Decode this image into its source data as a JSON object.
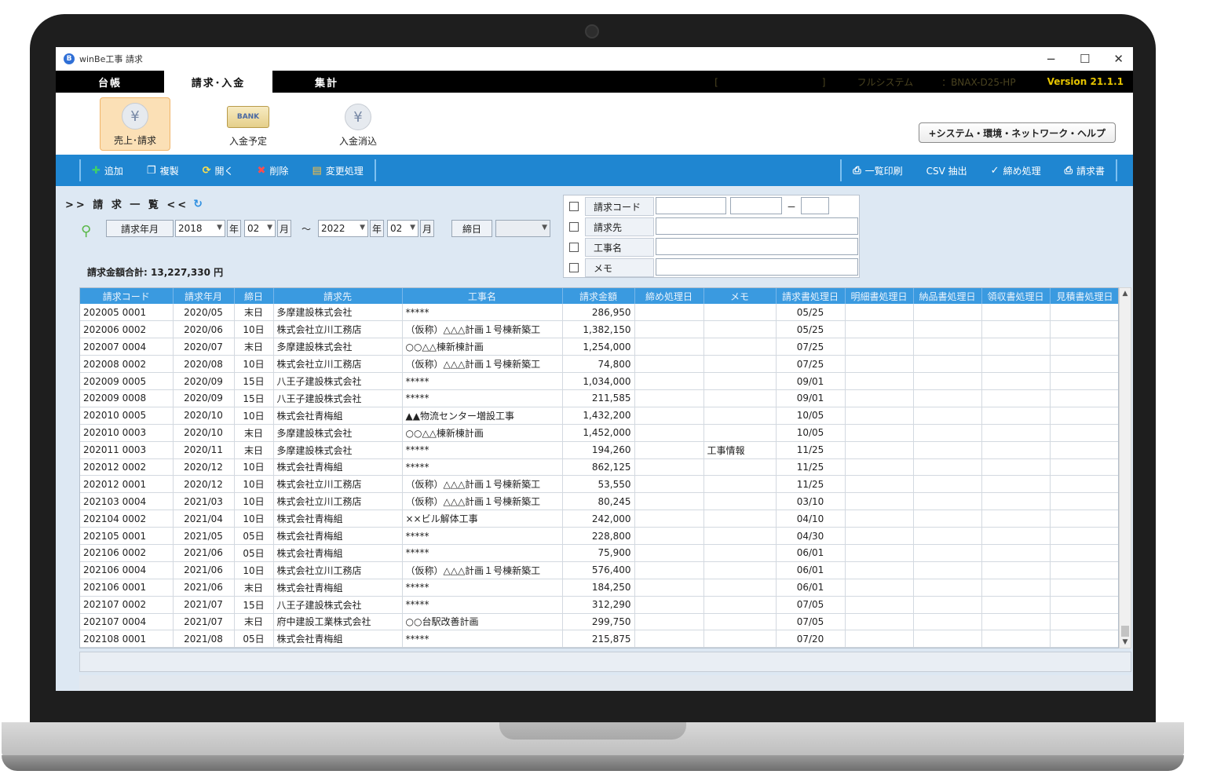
{
  "window": {
    "title": "winBe工事 請求",
    "controls": [
      "−",
      "☐",
      "✕"
    ]
  },
  "tabs": [
    {
      "label": "台帳"
    },
    {
      "label": "請求･入金"
    },
    {
      "label": "集計"
    }
  ],
  "tab_info": {
    "blurred_1": "[　　　　　　　　　　　]",
    "blurred_2": "フルシステム　　　：BNAX-D25-HP",
    "version": "Version 21.1.1"
  },
  "ribbon": {
    "sales_billing": "売上･請求",
    "bank_icon_text": "BANK",
    "deposit_plan": "入金予定",
    "deposit_clear": "入金消込",
    "yen_symbol": "¥",
    "system_help": "+システム・環境・ネットワーク・ヘルプ"
  },
  "toolbar": {
    "add": "追加",
    "copy": "複製",
    "open": "開く",
    "delete": "削除",
    "change": "変更処理",
    "list_print": "一覧印刷",
    "csv_extract": "CSV 抽出",
    "closing": "締め処理",
    "invoice": "請求書"
  },
  "list": {
    "title": ">> 請 求 一 覧 <<",
    "total_label": "請求金額合計:",
    "total_value": "13,227,330 円"
  },
  "period": {
    "label": "請求年月",
    "from_year": "2018",
    "from_month": "02",
    "to_year": "2022",
    "to_month": "02",
    "year_unit": "年",
    "month_unit": "月",
    "tilde": "～",
    "closing_label": "締日",
    "closing_value": ""
  },
  "filters": {
    "code_label": "請求コード",
    "code_dash": "－",
    "client_label": "請求先",
    "project_label": "工事名",
    "memo_label": "メモ"
  },
  "grid": {
    "headers": [
      "請求コード",
      "請求年月",
      "締日",
      "請求先",
      "工事名",
      "請求金額",
      "締め処理日",
      "メモ",
      "請求書処理日",
      "明細書処理日",
      "納品書処理日",
      "領収書処理日",
      "見積書処理日"
    ],
    "rows": [
      [
        "202005 0001",
        "2020/05",
        "末日",
        "多摩建設株式会社",
        "*****",
        "286,950",
        "",
        "",
        "05/25",
        "",
        "",
        "",
        ""
      ],
      [
        "202006 0002",
        "2020/06",
        "10日",
        "株式会社立川工務店",
        "（仮称）△△△計画１号棟新築工",
        "1,382,150",
        "",
        "",
        "05/25",
        "",
        "",
        "",
        ""
      ],
      [
        "202007 0004",
        "2020/07",
        "末日",
        "多摩建設株式会社",
        "○○△△棟新棟計画",
        "1,254,000",
        "",
        "",
        "07/25",
        "",
        "",
        "",
        ""
      ],
      [
        "202008 0002",
        "2020/08",
        "10日",
        "株式会社立川工務店",
        "（仮称）△△△計画１号棟新築工",
        "74,800",
        "",
        "",
        "07/25",
        "",
        "",
        "",
        ""
      ],
      [
        "202009 0005",
        "2020/09",
        "15日",
        "八王子建設株式会社",
        "*****",
        "1,034,000",
        "",
        "",
        "09/01",
        "",
        "",
        "",
        ""
      ],
      [
        "202009 0008",
        "2020/09",
        "15日",
        "八王子建設株式会社",
        "*****",
        "211,585",
        "",
        "",
        "09/01",
        "",
        "",
        "",
        ""
      ],
      [
        "202010 0005",
        "2020/10",
        "10日",
        "株式会社青梅組",
        "▲▲物流センター増設工事",
        "1,432,200",
        "",
        "",
        "10/05",
        "",
        "",
        "",
        ""
      ],
      [
        "202010 0003",
        "2020/10",
        "末日",
        "多摩建設株式会社",
        "○○△△棟新棟計画",
        "1,452,000",
        "",
        "",
        "10/05",
        "",
        "",
        "",
        ""
      ],
      [
        "202011 0003",
        "2020/11",
        "末日",
        "多摩建設株式会社",
        "*****",
        "194,260",
        "",
        "工事情報",
        "11/25",
        "",
        "",
        "",
        ""
      ],
      [
        "202012 0002",
        "2020/12",
        "10日",
        "株式会社青梅組",
        "*****",
        "862,125",
        "",
        "",
        "11/25",
        "",
        "",
        "",
        ""
      ],
      [
        "202012 0001",
        "2020/12",
        "10日",
        "株式会社立川工務店",
        "（仮称）△△△計画１号棟新築工",
        "53,550",
        "",
        "",
        "11/25",
        "",
        "",
        "",
        ""
      ],
      [
        "202103 0004",
        "2021/03",
        "10日",
        "株式会社立川工務店",
        "（仮称）△△△計画１号棟新築工",
        "80,245",
        "",
        "",
        "03/10",
        "",
        "",
        "",
        ""
      ],
      [
        "202104 0002",
        "2021/04",
        "10日",
        "株式会社青梅組",
        "××ビル解体工事",
        "242,000",
        "",
        "",
        "04/10",
        "",
        "",
        "",
        ""
      ],
      [
        "202105 0001",
        "2021/05",
        "05日",
        "株式会社青梅組",
        "*****",
        "228,800",
        "",
        "",
        "04/30",
        "",
        "",
        "",
        ""
      ],
      [
        "202106 0002",
        "2021/06",
        "05日",
        "株式会社青梅組",
        "*****",
        "75,900",
        "",
        "",
        "06/01",
        "",
        "",
        "",
        ""
      ],
      [
        "202106 0004",
        "2021/06",
        "10日",
        "株式会社立川工務店",
        "（仮称）△△△計画１号棟新築工",
        "576,400",
        "",
        "",
        "06/01",
        "",
        "",
        "",
        ""
      ],
      [
        "202106 0001",
        "2021/06",
        "末日",
        "株式会社青梅組",
        "*****",
        "184,250",
        "",
        "",
        "06/01",
        "",
        "",
        "",
        ""
      ],
      [
        "202107 0002",
        "2021/07",
        "15日",
        "八王子建設株式会社",
        "*****",
        "312,290",
        "",
        "",
        "07/05",
        "",
        "",
        "",
        ""
      ],
      [
        "202107 0004",
        "2021/07",
        "末日",
        "府中建設工業株式会社",
        "○○台駅改善計画",
        "299,750",
        "",
        "",
        "07/05",
        "",
        "",
        "",
        ""
      ],
      [
        "202108 0001",
        "2021/08",
        "05日",
        "株式会社青梅組",
        "*****",
        "215,875",
        "",
        "",
        "07/20",
        "",
        "",
        "",
        ""
      ]
    ]
  },
  "colors": {
    "toolbar_bg": "#1f86d1",
    "grid_header_bg": "#3a9ae0",
    "content_bg": "#dde8f3",
    "version_text": "#e6c400",
    "active_ribbon_bg": "#fbe0b6"
  }
}
